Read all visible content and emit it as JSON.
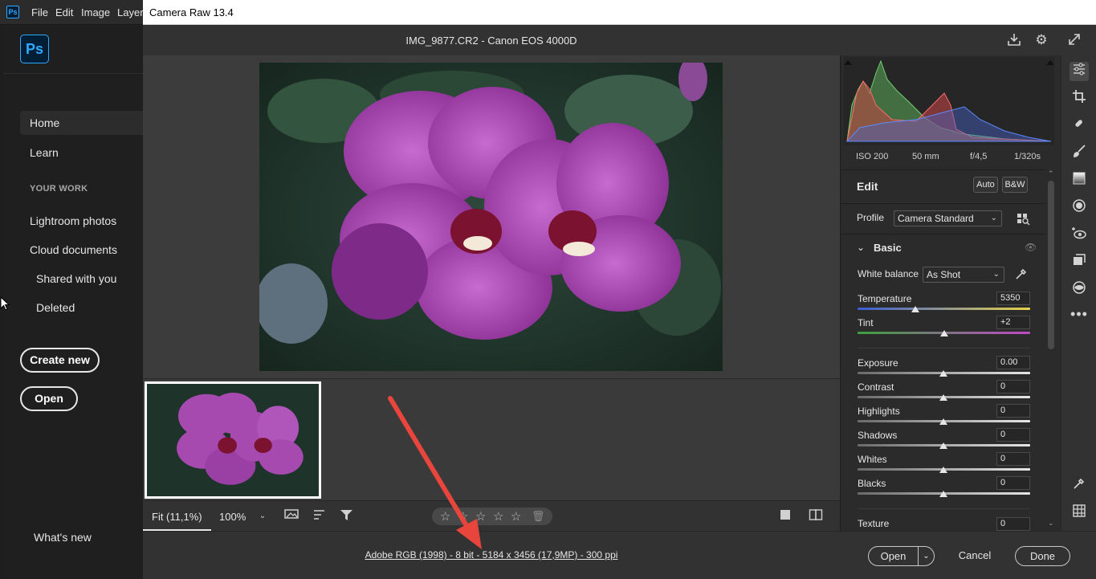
{
  "photoshop": {
    "menu": [
      "File",
      "Edit",
      "Image",
      "Layer"
    ],
    "logo": "Ps",
    "home": {
      "nav": [
        "Home",
        "Learn"
      ],
      "section_title": "YOUR WORK",
      "work_items": [
        "Lightroom photos",
        "Cloud documents",
        "Shared with you",
        "Deleted"
      ],
      "create_new": "Create new",
      "open": "Open",
      "whats_new": "What's new"
    }
  },
  "camera_raw": {
    "window_title": "Camera Raw 13.4",
    "file_title": "IMG_9877.CR2  -  Canon EOS 4000D",
    "exif": {
      "iso": "ISO 200",
      "focal": "50 mm",
      "aperture": "f/4,5",
      "shutter": "1/320s"
    },
    "edit": {
      "title": "Edit",
      "auto_button": "Auto",
      "bw_button": "B&W",
      "profile_label": "Profile",
      "profile_value": "Camera Standard",
      "basic_title": "Basic",
      "wb_label": "White balance",
      "wb_value": "As Shot",
      "sliders": [
        {
          "label": "Temperature",
          "value": "5350",
          "position": 0.34
        },
        {
          "label": "Tint",
          "value": "+2",
          "position": 0.51
        },
        {
          "label": "Exposure",
          "value": "0.00",
          "position": 0.5
        },
        {
          "label": "Contrast",
          "value": "0",
          "position": 0.5
        },
        {
          "label": "Highlights",
          "value": "0",
          "position": 0.5
        },
        {
          "label": "Shadows",
          "value": "0",
          "position": 0.5
        },
        {
          "label": "Whites",
          "value": "0",
          "position": 0.5
        },
        {
          "label": "Blacks",
          "value": "0",
          "position": 0.5
        },
        {
          "label": "Texture",
          "value": "0",
          "position": 0.5
        }
      ]
    },
    "toolbar": {
      "fit": "Fit (11,1%)",
      "zoom": "100%"
    },
    "footer": {
      "info": "Adobe RGB (1998) - 8 bit - 5184 x 3456 (17,9MP) - 300 ppi",
      "open": "Open",
      "cancel": "Cancel",
      "done": "Done"
    },
    "accent_color": "#e8453c"
  }
}
